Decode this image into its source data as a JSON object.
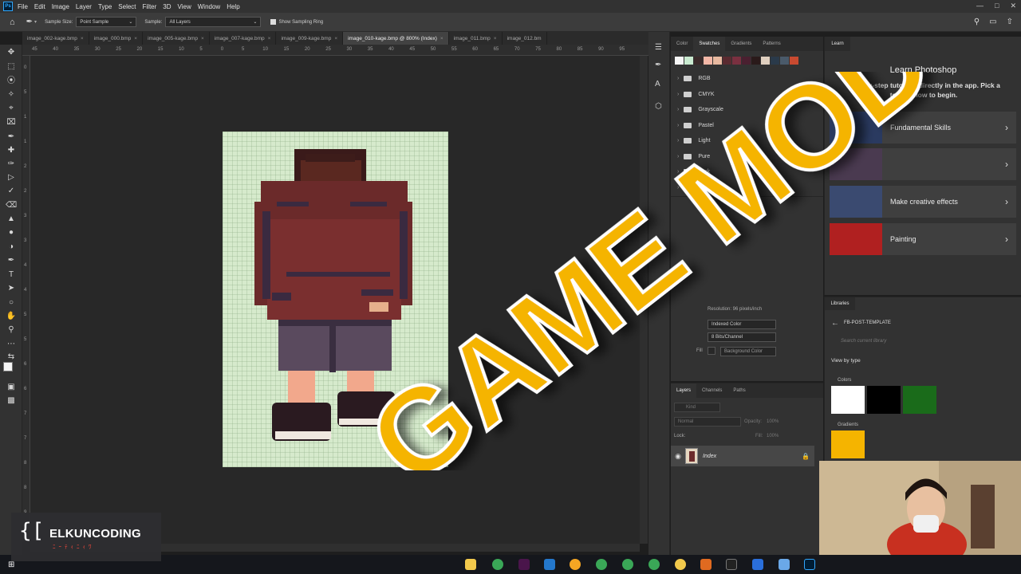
{
  "menubar": {
    "items": [
      "File",
      "Edit",
      "Image",
      "Layer",
      "Type",
      "Select",
      "Filter",
      "3D",
      "View",
      "Window",
      "Help"
    ]
  },
  "options_bar": {
    "sample_size_label": "Sample Size:",
    "sample_size_value": "Point Sample",
    "sample_label": "Sample:",
    "sample_value": "All Layers",
    "show_ring_label": "Show Sampling Ring"
  },
  "tabs": [
    {
      "label": "image_002-kage.bmp",
      "active": false
    },
    {
      "label": "image_000.bmp",
      "active": false
    },
    {
      "label": "image_005-kage.bmp",
      "active": false
    },
    {
      "label": "image_007-kage.bmp",
      "active": false
    },
    {
      "label": "image_009-kage.bmp",
      "active": false
    },
    {
      "label": "image_010-kage.bmp @ 800% (Index)",
      "active": true
    },
    {
      "label": "image_011.bmp",
      "active": false
    },
    {
      "label": "image_012.bm",
      "active": false
    }
  ],
  "ruler_top_ticks": [
    "45",
    "40",
    "35",
    "30",
    "25",
    "20",
    "15",
    "10",
    "5",
    "0",
    "5",
    "10",
    "15",
    "20",
    "25",
    "30",
    "35",
    "40",
    "45",
    "50",
    "55",
    "60",
    "65",
    "70",
    "75",
    "80",
    "85",
    "90",
    "95"
  ],
  "ruler_left_ticks": [
    "0",
    "5",
    "1",
    "1",
    "2",
    "2",
    "3",
    "3",
    "4",
    "4",
    "5",
    "5",
    "6",
    "6",
    "7",
    "7",
    "8",
    "8",
    "9"
  ],
  "swatches_panel": {
    "tabs": [
      "Color",
      "Swatches",
      "Gradients",
      "Patterns"
    ],
    "active_tab": "Swatches",
    "swatch_colors": [
      "#f5f5f5",
      "#c9ead0",
      "#3a2a2a",
      "#f3b7a6",
      "#e8b9a0",
      "#5a2a30",
      "#7a3040",
      "#4a2030",
      "#2a1a1a",
      "#e0d0c0",
      "#2a3a4a",
      "#4a5a6a",
      "#c84a30"
    ],
    "folders": [
      "RGB",
      "CMYK",
      "Grayscale",
      "Pastel",
      "Light",
      "Pure",
      "Dark",
      "Darker"
    ]
  },
  "properties_panel": {
    "resolution_text": "Resolution: 96 pixels/inch",
    "mode_value": "Indexed Color",
    "depth_value": "8 Bits/Channel",
    "fill_label": "Fill",
    "fill_value": "Background Color",
    "adjust_label": "Adjus"
  },
  "layers_panel": {
    "tabs": [
      "Layers",
      "Channels",
      "Paths"
    ],
    "kind_placeholder": "Kind",
    "blend_mode": "Normal",
    "opacity_label": "Opacity:",
    "opacity_value": "100%",
    "lock_label": "Lock:",
    "fill_label": "Fill:",
    "fill_value": "100%",
    "layer_name": "Index"
  },
  "learn_panel": {
    "tab": "Learn",
    "title": "Learn Photoshop",
    "subtitle": "Step-by-step tutorials directly in the app. Pick a topic below to begin.",
    "cards": [
      {
        "label": "Fundamental Skills",
        "color": "#2a3a60"
      },
      {
        "label": "",
        "color": "#4a3a50"
      },
      {
        "label": "Make creative effects",
        "color": "#3a4a70"
      },
      {
        "label": "Painting",
        "color": "#b02020"
      }
    ]
  },
  "libraries_panel": {
    "tab": "Libraries",
    "library_name": "FB-POST-TEMPLATE",
    "search_placeholder": "Search current library",
    "view_by": "View by type",
    "colors_label": "Colors",
    "colors": [
      "#ffffff",
      "#000000",
      "#1a6b1a"
    ],
    "gradients_label": "Gradients",
    "gradient_color": "#f5b400"
  },
  "overlay": {
    "text": "GAME MOD",
    "color": "#f5b400"
  },
  "brand": {
    "bracket": "{[",
    "name_a": "ELKUN",
    "name_b": "CODING",
    "sub": "ﾆｰﾃｨﾆｨﾜ"
  }
}
